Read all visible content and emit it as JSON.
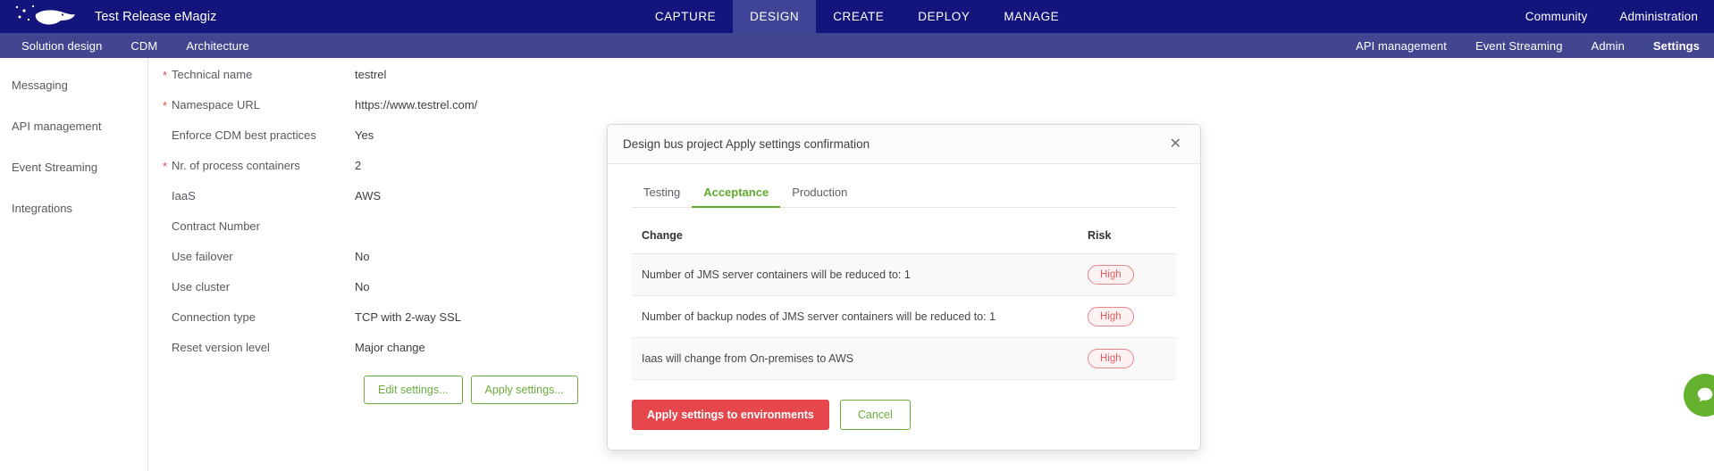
{
  "header": {
    "brand_title": "Test Release eMagiz",
    "logo_icon": "whale-logo-icon",
    "nav": [
      {
        "label": "CAPTURE",
        "active": false
      },
      {
        "label": "DESIGN",
        "active": true
      },
      {
        "label": "CREATE",
        "active": false
      },
      {
        "label": "DEPLOY",
        "active": false
      },
      {
        "label": "MANAGE",
        "active": false
      }
    ],
    "right_nav": [
      {
        "label": "Community"
      },
      {
        "label": "Administration"
      }
    ]
  },
  "subheader": {
    "left": [
      {
        "label": "Solution design",
        "active": false
      },
      {
        "label": "CDM",
        "active": false
      },
      {
        "label": "Architecture",
        "active": false
      }
    ],
    "right": [
      {
        "label": "API management",
        "active": false
      },
      {
        "label": "Event Streaming",
        "active": false
      },
      {
        "label": "Admin",
        "active": false
      },
      {
        "label": "Settings",
        "active": true
      }
    ]
  },
  "sidebar": {
    "items": [
      {
        "label": "Messaging"
      },
      {
        "label": "API management"
      },
      {
        "label": "Event Streaming"
      },
      {
        "label": "Integrations"
      }
    ]
  },
  "form": {
    "fields": [
      {
        "label": "Technical name",
        "value": "testrel",
        "required": true
      },
      {
        "label": "Namespace URL",
        "value": "https://www.testrel.com/",
        "required": true
      },
      {
        "label": "Enforce CDM best practices",
        "value": "Yes",
        "required": false
      },
      {
        "label": "Nr. of process containers",
        "value": "2",
        "required": true
      },
      {
        "label": "IaaS",
        "value": "AWS",
        "required": false
      },
      {
        "label": "Contract Number",
        "value": "",
        "required": false
      },
      {
        "label": "Use failover",
        "value": "No",
        "required": false
      },
      {
        "label": "Use cluster",
        "value": "No",
        "required": false
      },
      {
        "label": "Connection type",
        "value": "TCP with 2-way SSL",
        "required": false
      },
      {
        "label": "Reset version level",
        "value": "Major change",
        "required": false
      }
    ],
    "edit_button": "Edit settings...",
    "apply_button": "Apply settings..."
  },
  "modal": {
    "title": "Design bus project Apply settings confirmation",
    "close_icon": "close-icon",
    "tabs": [
      {
        "label": "Testing",
        "active": false
      },
      {
        "label": "Acceptance",
        "active": true
      },
      {
        "label": "Production",
        "active": false
      }
    ],
    "table": {
      "headers": {
        "change": "Change",
        "risk": "Risk"
      },
      "rows": [
        {
          "change": "Number of JMS server containers will be reduced to: 1",
          "risk": "High"
        },
        {
          "change": "Number of backup nodes of JMS server containers will be reduced to: 1",
          "risk": "High"
        },
        {
          "change": "Iaas will change from On-premises to AWS",
          "risk": "High"
        }
      ]
    },
    "apply_button": "Apply settings to environments",
    "cancel_button": "Cancel"
  },
  "chat": {
    "icon": "chat-support-icon"
  },
  "colors": {
    "topbar": "#14157c",
    "subbar": "#42458f",
    "active_tab": "#3f4496",
    "green": "#6aad3d",
    "green_tab": "#5eab2e",
    "danger": "#e5474c",
    "risk_badge": "#e05c62",
    "chat": "#64b22e"
  }
}
